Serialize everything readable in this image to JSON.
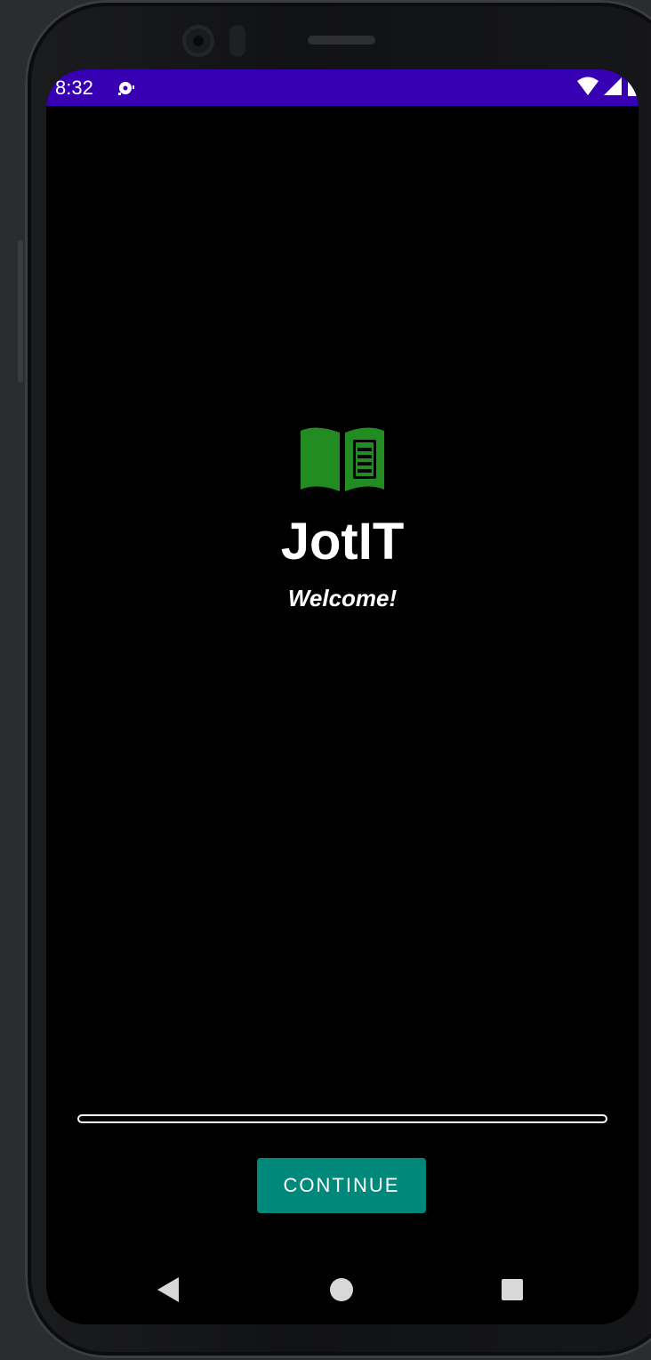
{
  "status_bar": {
    "time": "8:32",
    "notification_icon": "podcast-icon",
    "wifi_icon": "wifi-icon",
    "signal_icon": "cell-signal-icon",
    "battery_icon": "battery-icon",
    "background_color": "#3700b3"
  },
  "app": {
    "logo_icon": "open-book-icon",
    "logo_color": "#228b22",
    "title": "JotIT",
    "subtitle": "Welcome!"
  },
  "progress": {
    "value": 0
  },
  "continue_button": {
    "label": "CONTINUE",
    "color": "#00897b"
  },
  "navigation_bar": {
    "back_icon": "back-triangle-icon",
    "home_icon": "home-circle-icon",
    "recents_icon": "recents-square-icon"
  }
}
